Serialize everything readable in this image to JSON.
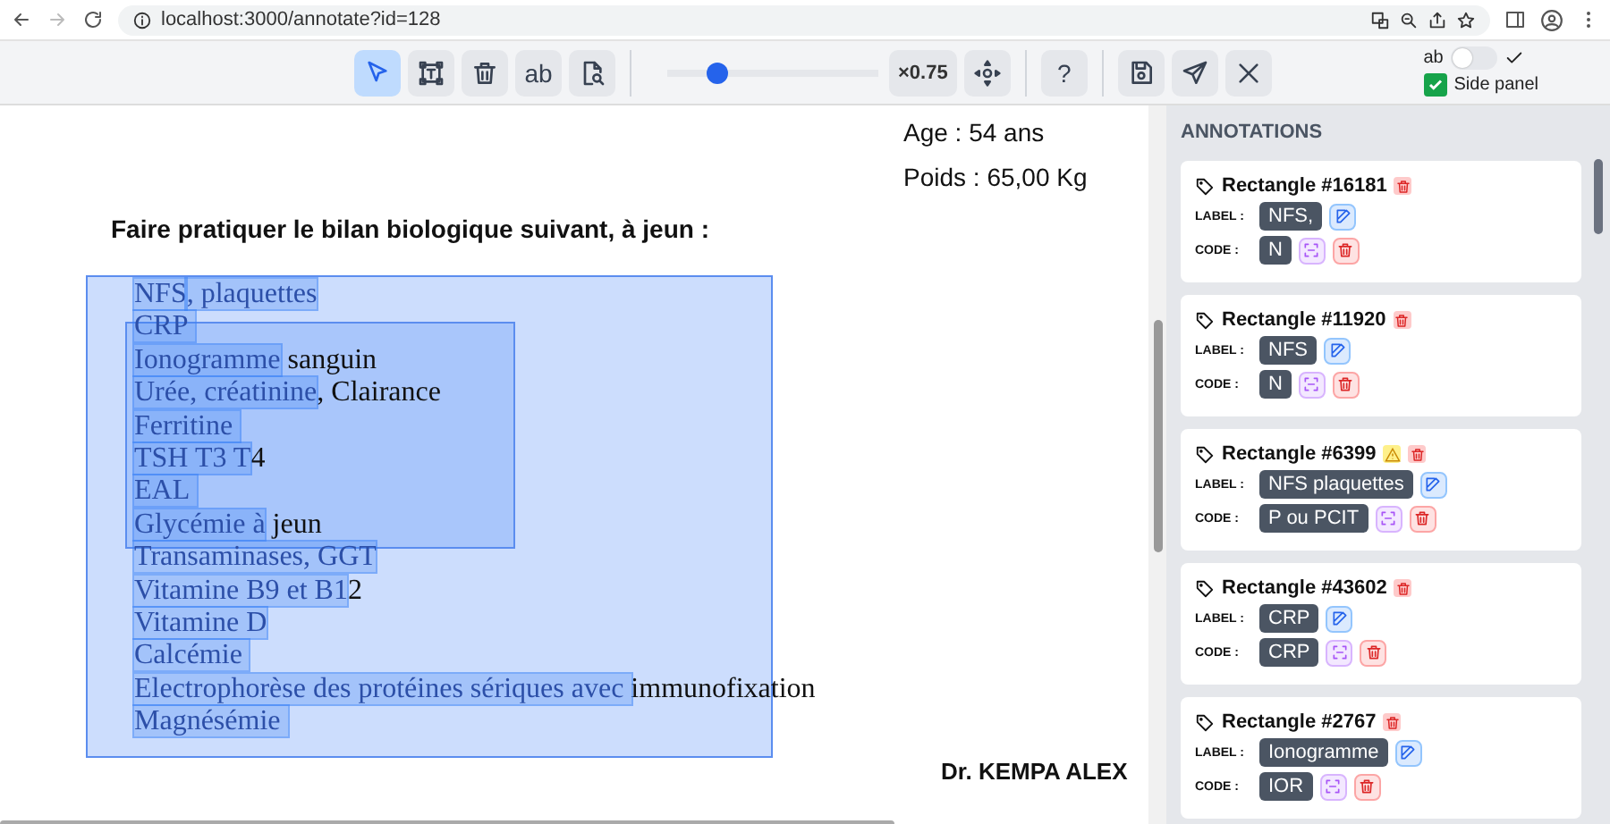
{
  "browser": {
    "url": "localhost:3000/annotate?id=128"
  },
  "toolbar": {
    "tools": [
      {
        "kind": "select",
        "selected": true
      },
      {
        "kind": "textbox",
        "selected": false
      },
      {
        "kind": "delete",
        "selected": false
      },
      {
        "kind": "text",
        "label": "ab",
        "selected": false
      },
      {
        "kind": "inspect",
        "selected": false
      }
    ],
    "zoom": {
      "level": 0.24,
      "label": "×0.75"
    },
    "help": "?",
    "actions": [
      {
        "kind": "save"
      },
      {
        "kind": "send"
      },
      {
        "kind": "close"
      }
    ],
    "toggle": {
      "label": "ab",
      "on": false
    },
    "side_panel": {
      "label": "Side panel",
      "checked": true
    }
  },
  "document": {
    "age": "Age : 54 ans",
    "weight": "Poids : 65,00 Kg",
    "instruction": "Faire pratiquer le bilan biologique suivant, à jeun :",
    "lines": [
      [
        {
          "text": "NFS",
          "highlighted": true
        },
        {
          "text": ", plaquettes",
          "highlighted": true
        }
      ],
      [
        {
          "text": "CRP ",
          "highlighted": true
        }
      ],
      [
        {
          "text": "Ionogramme",
          "highlighted": true
        },
        {
          "text": " sanguin",
          "highlighted": false
        }
      ],
      [
        {
          "text": "Urée, créatinine",
          "highlighted": true
        },
        {
          "text": ", Clairance",
          "highlighted": false
        }
      ],
      [
        {
          "text": "Ferritine ",
          "highlighted": true
        }
      ],
      [
        {
          "text": "TSH T3 T",
          "highlighted": true
        },
        {
          "text": "4",
          "highlighted": false
        }
      ],
      [
        {
          "text": "EAL ",
          "highlighted": true
        }
      ],
      [
        {
          "text": "Glycémie à",
          "highlighted": true
        },
        {
          "text": " jeun",
          "highlighted": false
        }
      ],
      [
        {
          "text": "Transaminases, GGT",
          "highlighted": true
        }
      ],
      [
        {
          "text": "Vitamine B9 et B1",
          "highlighted": true
        },
        {
          "text": "2",
          "highlighted": false
        }
      ],
      [
        {
          "text": "Vitamine D",
          "highlighted": true
        }
      ],
      [
        {
          "text": "Calcémie ",
          "highlighted": true
        }
      ],
      [
        {
          "text": "Electrophorèse des protéines sériques avec ",
          "highlighted": true
        },
        {
          "text": "immunofixation",
          "highlighted": false
        }
      ],
      [
        {
          "text": "Magnésémie ",
          "highlighted": true
        }
      ]
    ],
    "signature": "Dr. KEMPA ALEX"
  },
  "panel": {
    "title": "ANNOTATIONS",
    "annotations": [
      {
        "title": "Rectangle #16181",
        "warning": false,
        "label_caption": "LABEL :",
        "label": "NFS,",
        "code_caption": "CODE :",
        "code": "N"
      },
      {
        "title": "Rectangle #11920",
        "warning": false,
        "label_caption": "LABEL :",
        "label": "NFS",
        "code_caption": "CODE :",
        "code": "N"
      },
      {
        "title": "Rectangle #6399",
        "warning": true,
        "label_caption": "LABEL :",
        "label": "NFS plaquettes",
        "code_caption": "CODE :",
        "code": "P ou PCIT"
      },
      {
        "title": "Rectangle #43602",
        "warning": false,
        "label_caption": "LABEL :",
        "label": "CRP",
        "code_caption": "CODE :",
        "code": "CRP"
      },
      {
        "title": "Rectangle #2767",
        "warning": false,
        "label_caption": "LABEL :",
        "label": "Ionogramme",
        "code_caption": "CODE :",
        "code": "IOR"
      }
    ]
  }
}
